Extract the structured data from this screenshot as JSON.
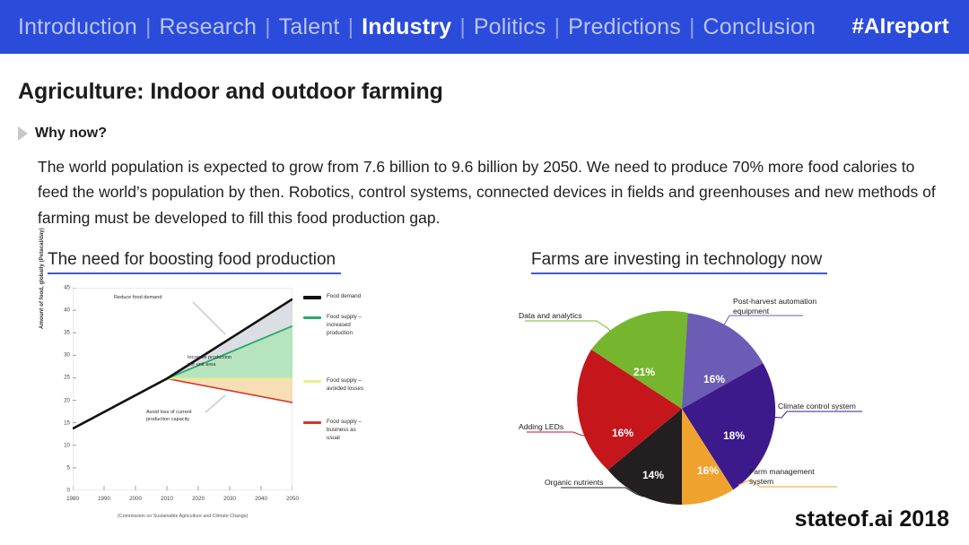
{
  "nav": {
    "items": [
      {
        "label": "Introduction",
        "active": false
      },
      {
        "label": "Research",
        "active": false
      },
      {
        "label": "Talent",
        "active": false
      },
      {
        "label": "Industry",
        "active": true
      },
      {
        "label": "Politics",
        "active": false
      },
      {
        "label": "Predictions",
        "active": false
      },
      {
        "label": "Conclusion",
        "active": false
      }
    ],
    "separator": "|",
    "hashtag": "#AIreport",
    "bar_color": "#2b4bdb"
  },
  "slide": {
    "title": "Agriculture: Indoor and outdoor farming",
    "why_label": "Why now?",
    "body": "The world population is expected to grow from 7.6 billion to 9.6 billion by 2050. We need to produce 70% more food calories to feed the world’s population by then. Robotics, control systems, connected devices in fields and greenhouses and new methods of farming must be developed to fill this food production gap.",
    "brand": "stateof.ai 2018",
    "accent_color": "#4159c4"
  },
  "panels": {
    "left_heading": "The need for boosting food production",
    "right_heading": "Farms are investing in technology now"
  },
  "chart_data": [
    {
      "type": "area",
      "title": "The need for boosting food production",
      "xlabel": "",
      "ylabel": "Amount of food, globally (Petacal/day)",
      "source": "(Commission on Sustainable Agriculture and Climate Change)",
      "xlim": [
        1980,
        2050
      ],
      "ylim": [
        0,
        45
      ],
      "xticks": [
        1980,
        1990,
        2000,
        2010,
        2020,
        2030,
        2040,
        2050
      ],
      "yticks": [
        0,
        5,
        10,
        15,
        20,
        25,
        30,
        35,
        40,
        45
      ],
      "grid": false,
      "legend_position": "right",
      "annotations": [
        {
          "text": "Reduce food demand",
          "x": 2022,
          "y": 41
        },
        {
          "text": "Increase production\nper unit area",
          "x": 2028,
          "y": 29
        },
        {
          "text": "Avoid loss of current\nproduction capacity",
          "x": 2024,
          "y": 16
        }
      ],
      "series": [
        {
          "name": "Food demand",
          "color": "#1a1a1a",
          "x": [
            1980,
            2010,
            2050
          ],
          "values": [
            13.7,
            24.8,
            42.5
          ]
        },
        {
          "name": "Food supply –\nincreased\nproduction",
          "color": "#26a96c",
          "x": [
            1980,
            2010,
            2050
          ],
          "values": [
            13.7,
            24.8,
            36.5
          ]
        },
        {
          "name": "Food supply –\navoided losses",
          "color": "#e8ef8a",
          "x": [
            1980,
            2010,
            2050
          ],
          "values": [
            13.7,
            24.8,
            24.8
          ]
        },
        {
          "name": "Food supply –\nbusiness as\nusual",
          "color": "#d9342b",
          "x": [
            1980,
            2010,
            2050
          ],
          "values": [
            13.7,
            24.8,
            19.5
          ]
        }
      ]
    },
    {
      "type": "pie",
      "title": "Farms are investing in technology now",
      "legend_position": "callout-labels",
      "labels": [
        "Post-harvest automation\nequipment",
        "Climate control system",
        "Farm management\nsystem",
        "Organic nutrients",
        "Adding LEDs",
        "Data and analytics"
      ],
      "values": [
        16,
        18,
        16,
        14,
        16,
        21
      ],
      "value_labels": [
        "16%",
        "18%",
        "16%",
        "14%",
        "16%",
        "21%"
      ],
      "colors": [
        "#6c5cb5",
        "#3c1a8c",
        "#f0a22e",
        "#231f20",
        "#c5161c",
        "#76b62f"
      ],
      "pct_text_colors": [
        "#ffffff",
        "#ffffff",
        "#ffffff",
        "#ffffff",
        "#ffffff",
        "#ffffff"
      ]
    }
  ]
}
